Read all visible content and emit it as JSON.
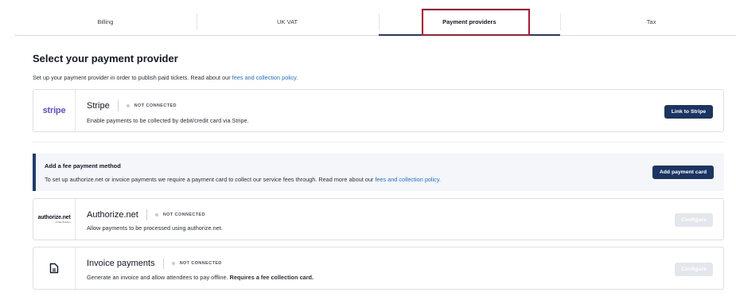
{
  "tabs": [
    {
      "label": "Billing"
    },
    {
      "label": "UK VAT"
    },
    {
      "label": "Payment providers"
    },
    {
      "label": "Tax"
    }
  ],
  "active_tab": "Payment providers",
  "page": {
    "title": "Select your payment provider",
    "description_prefix": "Set up your payment provider in order to publish paid tickets. Read about our ",
    "description_link": "fees and collection policy."
  },
  "providers": {
    "stripe": {
      "logo_text": "stripe",
      "name": "Stripe",
      "status": "NOT CONNECTED",
      "description": "Enable payments to be collected by debit/credit card via Stripe.",
      "button_label": "Link to Stripe"
    },
    "authorize_net": {
      "logo_text": "authorize.net",
      "logo_subtext": "A Visa Solution",
      "name": "Authorize.net",
      "status": "NOT CONNECTED",
      "description": "Allow payments to be processed using authorize.net.",
      "button_label": "Configure"
    },
    "invoice": {
      "icon": "document-icon",
      "name": "Invoice payments",
      "status": "NOT CONNECTED",
      "description_prefix": "Generate an invoice and allow attendees to pay offline. ",
      "description_bold": "Requires a fee collection card.",
      "button_label": "Configure"
    }
  },
  "fee_banner": {
    "title": "Add a fee payment method",
    "description_prefix": "To set up authorize.net or invoice payments we require a payment card to collect our service fees through. Read more about our ",
    "description_link": "fees and collection policy.",
    "button_label": "Add payment card"
  },
  "colors": {
    "accent": "#1b3c7a",
    "primary_button": "#1b3562",
    "link": "#1e6fd9",
    "stripe_brand": "#5a4fe0",
    "highlight": "#c8102e"
  }
}
